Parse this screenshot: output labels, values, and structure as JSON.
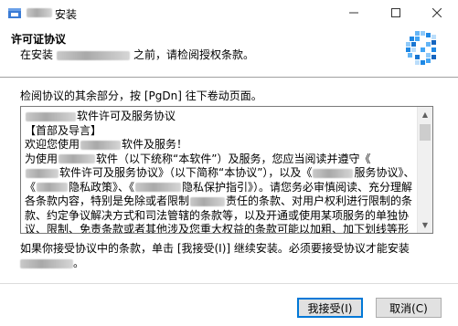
{
  "window": {
    "title": "安装",
    "minimize_label": "—",
    "maximize_label": "☐",
    "close_label": "✕"
  },
  "header": {
    "title": "许可证协议",
    "subtitle_prefix": "在安装",
    "subtitle_suffix": "之前，请检阅授权条款。"
  },
  "instruction": "检阅协议的其余部分，按 [PgDn] 往下卷动页面。",
  "license": {
    "lines": [
      {
        "pre": "",
        "blur": 55,
        "post": "软件许可及服务协议"
      },
      {
        "pre": "【首部及导言】",
        "blur": 0,
        "post": ""
      },
      {
        "pre": "欢迎您使用",
        "blur": 44,
        "post": "软件及服务！"
      },
      {
        "pre": "为使用",
        "blur": 40,
        "post": "软件（以下统称“本软件”）及服务，您应当阅读并遵守《"
      },
      {
        "pre": "",
        "blur": 36,
        "post": "软件许可及服务协议》（以下简称“本协议”），以及《",
        "blur2": 44,
        "post2": "服务协议》、"
      },
      {
        "pre": "《",
        "blur": 34,
        "post": "隐私政策》、《",
        "blur2": 50,
        "post2": "隐私保护指引》）。请您务必审慎阅读、充分理解"
      },
      {
        "pre": "各条款内容，特别是免除或者限制",
        "blur": 38,
        "post": "责任的条款、对用户权利进行限制的条"
      },
      {
        "pre": "款、约定争议解决方式和司法管辖的条款等，以及开通或使用某项服务的单独协"
      },
      {
        "pre": "议、限制、免责条款或者其他涉及您重大权益的条款可能以加粗、加下划线等形"
      }
    ],
    "scroll_up": "▲",
    "scroll_down": "▼"
  },
  "footer": {
    "line1": "如果你接受协议中的条款，单击 [我接受(I)] 继续安装。必须要接受协议才能安装",
    "line2_suffix": "。"
  },
  "buttons": {
    "accept": "我接受(I)",
    "cancel": "取消(C)"
  },
  "colors": {
    "accent_border": "#0078d7",
    "logo_blue": "#1e88e5"
  },
  "icons": {
    "app": "installer-app-icon",
    "header_logo": "pixelated-logo-icon"
  }
}
